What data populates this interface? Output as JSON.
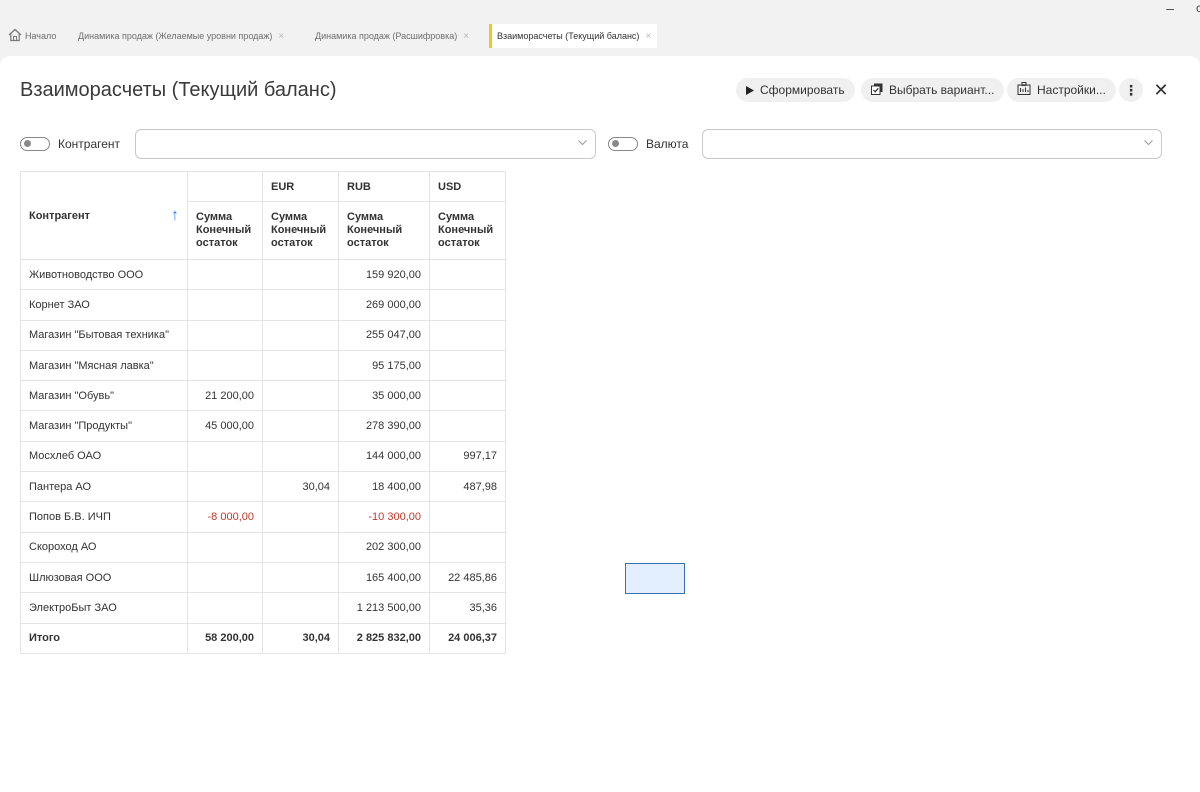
{
  "window": {
    "minimize": "–",
    "right_char": "c"
  },
  "tabs": [
    {
      "label": "Начало",
      "closable": false
    },
    {
      "label": "Динамика продаж (Желаемые уровни продаж)",
      "closable": true
    },
    {
      "label": "Динамика продаж (Расшифровка)",
      "closable": true
    },
    {
      "label": "Взаиморасчеты (Текущий баланс)",
      "closable": true,
      "active": true
    }
  ],
  "tab_close_glyph": "×",
  "page": {
    "title": "Взаиморасчеты (Текущий баланс)"
  },
  "toolbar": {
    "generate": "Сформировать",
    "choose_variant": "Выбрать вариант...",
    "settings": "Настройки...",
    "more": "⋮",
    "close": "✕"
  },
  "filters": {
    "counterparty_label": "Контрагент",
    "counterparty_value": "",
    "currency_label": "Валюта",
    "currency_value": ""
  },
  "table": {
    "row_header": "Контрагент",
    "currencies": [
      "",
      "EUR",
      "RUB",
      "USD"
    ],
    "measure_header": "Сумма Конечный остаток",
    "rows": [
      {
        "name": "Животноводство ООО",
        "vals": [
          "",
          "",
          "159 920,00",
          ""
        ]
      },
      {
        "name": "Корнет ЗАО",
        "vals": [
          "",
          "",
          "269 000,00",
          ""
        ]
      },
      {
        "name": "Магазин \"Бытовая техника\"",
        "vals": [
          "",
          "",
          "255 047,00",
          ""
        ]
      },
      {
        "name": "Магазин \"Мясная лавка\"",
        "vals": [
          "",
          "",
          "95 175,00",
          ""
        ]
      },
      {
        "name": "Магазин \"Обувь\"",
        "vals": [
          "21 200,00",
          "",
          "35 000,00",
          ""
        ]
      },
      {
        "name": "Магазин \"Продукты\"",
        "vals": [
          "45 000,00",
          "",
          "278 390,00",
          ""
        ]
      },
      {
        "name": "Мосхлеб ОАО",
        "vals": [
          "",
          "",
          "144 000,00",
          "997,17"
        ]
      },
      {
        "name": "Пантера АО",
        "vals": [
          "",
          "30,04",
          "18 400,00",
          "487,98"
        ]
      },
      {
        "name": "Попов Б.В. ИЧП",
        "vals": [
          "-8 000,00",
          "",
          "-10 300,00",
          ""
        ]
      },
      {
        "name": "Скороход АО",
        "vals": [
          "",
          "",
          "202 300,00",
          ""
        ]
      },
      {
        "name": "Шлюзовая ООО",
        "vals": [
          "",
          "",
          "165 400,00",
          "22 485,86"
        ]
      },
      {
        "name": "ЭлектроБыт ЗАО",
        "vals": [
          "",
          "",
          "1 213 500,00",
          "35,36"
        ]
      }
    ],
    "total": {
      "name": "Итого",
      "vals": [
        "58 200,00",
        "30,04",
        "2 825 832,00",
        "24 006,37"
      ]
    }
  },
  "colors": {
    "accent_tab": "#f5c518",
    "negative": "#c0392b",
    "sort_arrow": "#2d7ff9",
    "selection": "#e3efff"
  }
}
